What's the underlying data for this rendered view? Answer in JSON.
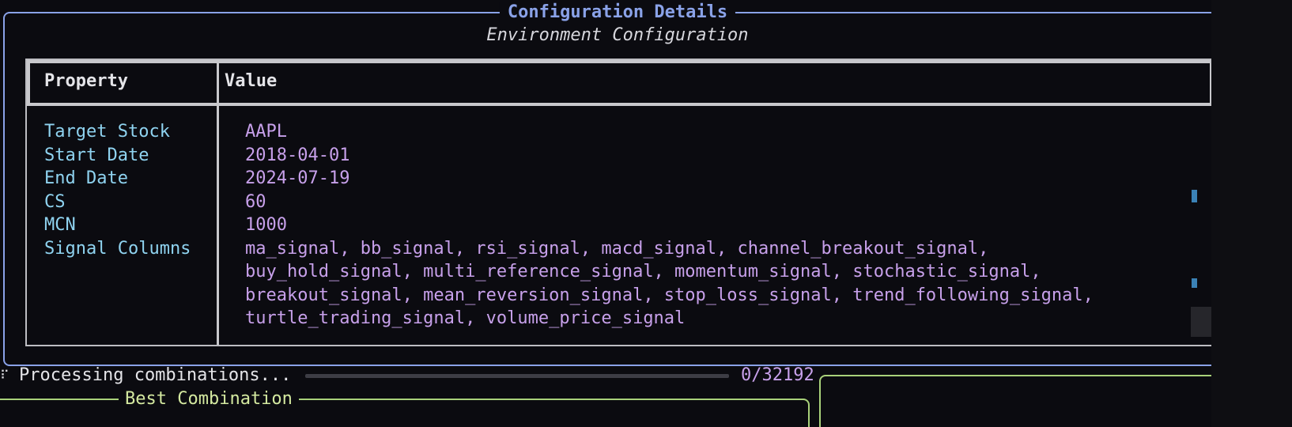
{
  "panel": {
    "title": "Configuration Details",
    "subtitle": "Environment Configuration",
    "border_color": "#8aa2e8"
  },
  "table": {
    "headers": [
      "Property",
      "Value"
    ],
    "rows": [
      {
        "property": "Target Stock",
        "value": "AAPL"
      },
      {
        "property": "Start Date",
        "value": "2018-04-01"
      },
      {
        "property": "End Date",
        "value": "2024-07-19"
      },
      {
        "property": "CS",
        "value": "60"
      },
      {
        "property": "MCN",
        "value": "1000"
      },
      {
        "property": "Signal Columns",
        "value": "ma_signal, bb_signal, rsi_signal, macd_signal, channel_breakout_signal,\nbuy_hold_signal, multi_reference_signal, momentum_signal, stochastic_signal,\nbreakout_signal, mean_reversion_signal, stop_loss_signal, trend_following_signal,\nturtle_trading_signal, volume_price_signal"
      }
    ],
    "property_color": "#8fd3f0",
    "value_color": "#c7a0ea"
  },
  "progress": {
    "spinner_icon": "spinner-icon",
    "label": "Processing combinations...",
    "count": "0/32192",
    "completed": 0,
    "total": 32192
  },
  "best_panel": {
    "title": "Best Combination",
    "border_color": "#a9d17a"
  }
}
